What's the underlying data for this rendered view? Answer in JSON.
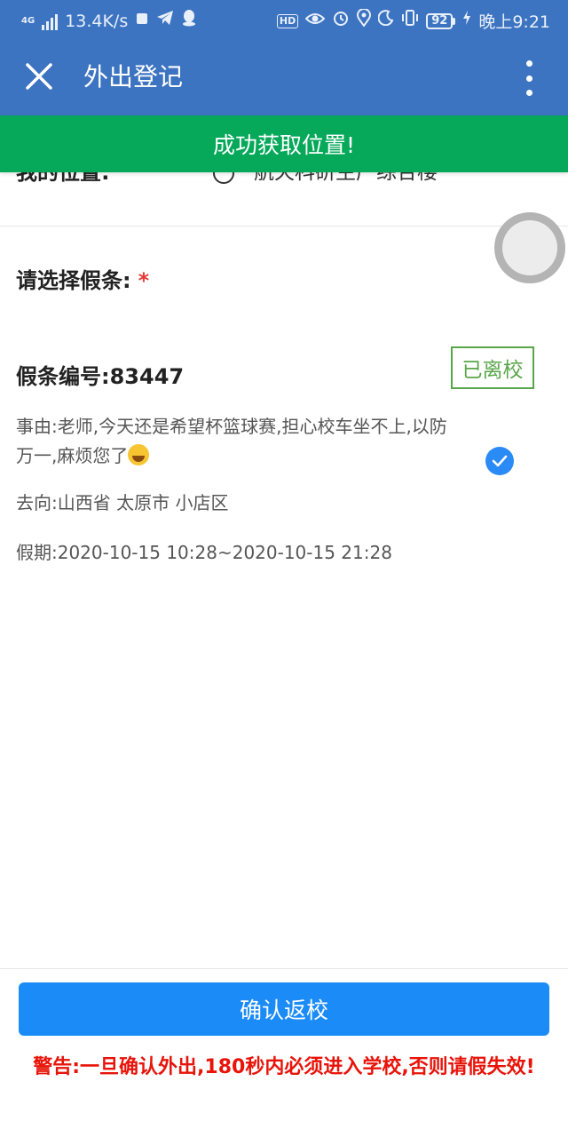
{
  "status_bar": {
    "network_type": "4G",
    "speed": "13.4K/s",
    "hd": "HD",
    "battery": "92",
    "time": "晚上9:21"
  },
  "app_bar": {
    "title": "外出登记"
  },
  "toast": {
    "text": "成功获取位置!"
  },
  "location": {
    "label": "我的位置:",
    "value": "航天科研生产综合楼"
  },
  "form": {
    "select_label": "请选择假条:",
    "required_mark": "*"
  },
  "slip": {
    "number_label": "假条编号:",
    "number": "83447",
    "status": "已离校",
    "reason": "事由:老师,今天还是希望杯篮球赛,担心校车坐不上,以防万一,麻烦您了",
    "destination": "去向:山西省 太原市 小店区",
    "period": "假期:2020-10-15 10:28~2020-10-15 21:28",
    "selected": true
  },
  "footer": {
    "confirm_label": "确认返校",
    "warning": "警告:一旦确认外出,180秒内必须进入学校,否则请假失效!"
  },
  "colors": {
    "primary_bar": "#3d74c1",
    "toast_green": "#06a85a",
    "button_blue": "#1b8bf8",
    "status_green": "#59a64a",
    "warning_red": "#e8140a"
  }
}
